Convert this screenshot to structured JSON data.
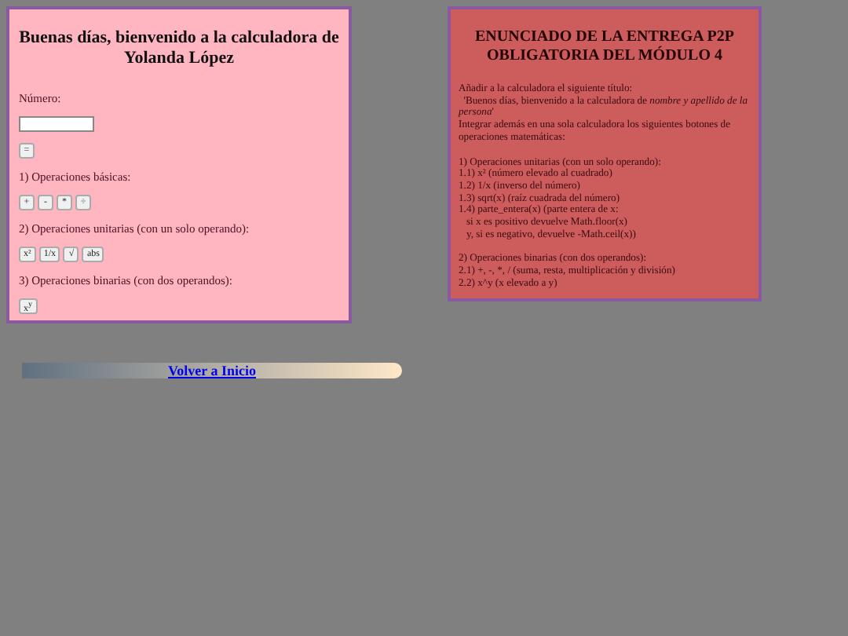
{
  "calculator": {
    "title": "Buenas días, bienvenido a la calculadora de Yolanda López",
    "number_label": "Número:",
    "equals": "=",
    "sections": [
      {
        "label": "1) Operaciones básicas:",
        "buttons": [
          "+",
          "-",
          "*",
          "÷"
        ]
      },
      {
        "label": "2) Operaciones unitarias (con un solo operando):",
        "buttons": [
          "x²",
          "1/x",
          "√",
          "abs"
        ]
      },
      {
        "label": "3) Operaciones binarias (con dos operandos):",
        "buttons": [
          "x$^{y}$"
        ]
      }
    ]
  },
  "statement": {
    "title": "ENUNCIADO DE LA ENTREGA P2P OBLIGATORIA DEL MÓDULO 4",
    "blocks": [
      [
        "Añadir a la calculadora el siguiente título:",
        "  'Buenos días, bienvenido a la calculadora de *nombre y apellido de la persona*'",
        "Integrar además en una sola calculadora los siguientes botones de operaciones matemáticas:"
      ],
      [
        "1) Operaciones unitarias (con un solo operando):",
        "1.1) x² (número elevado al cuadrado)",
        "1.2) 1/x (inverso del número)",
        "1.3) sqrt(x) (raíz cuadrada del número)",
        "1.4) parte_entera(x) (parte entera de x:",
        "   si x es positivo devuelve Math.floor(x)",
        "   y, si es negativo, devuelve -Math.ceil(x))"
      ],
      [
        "2) Operaciones binarias (con dos operandos):",
        "2.1) +, -, *, / (suma, resta, multiplicación y división)",
        "2.2) x^y (x elevado a y)"
      ]
    ]
  },
  "back_link": "Volver a Inicio"
}
